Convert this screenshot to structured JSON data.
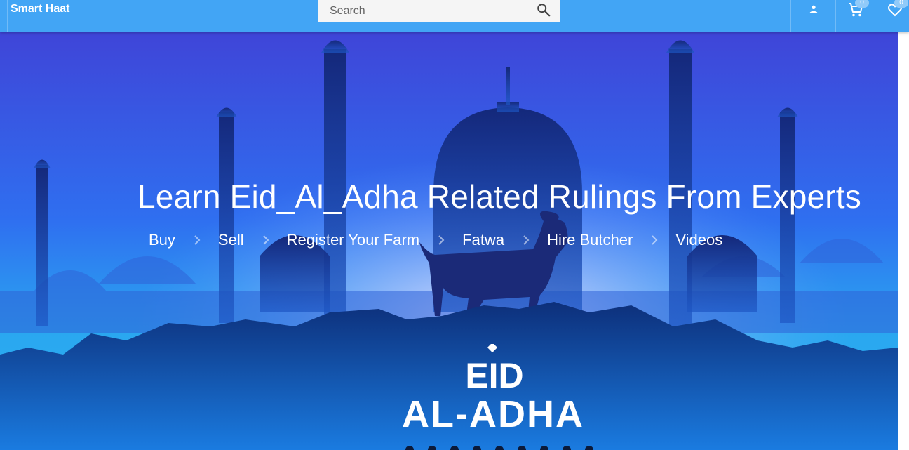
{
  "header": {
    "brand": "Smart Haat",
    "search_placeholder": "Search",
    "cart_count": "0",
    "wishlist_count": "0"
  },
  "hero": {
    "title": "Learn Eid_Al_Adha Related Rulings From Experts",
    "links": [
      "Buy",
      "Sell",
      "Register Your Farm",
      "Fatwa",
      "Hire Butcher",
      "Videos"
    ],
    "logo_text": [
      "EID",
      "AL-ADHA"
    ]
  },
  "icons": [
    "search-icon",
    "account-icon",
    "cart-icon",
    "heart-icon",
    "chevron-right-icon"
  ],
  "colors": {
    "topbar": "#42a5f5",
    "sky_top": "#3f45d8",
    "sky_bottom": "#2aa7f0",
    "silhouette": "#14287a"
  }
}
